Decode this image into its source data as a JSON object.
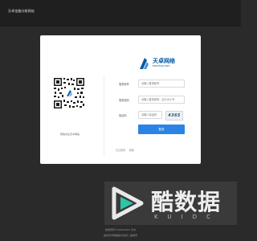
{
  "header": {
    "site_title": "天卓金路分校网站"
  },
  "login": {
    "logo_title": "天卓网络",
    "logo_subtitle": "tianzhuo.com",
    "account_label": "登录帐号",
    "account_placeholder": "请输入登录帐号",
    "password_label": "登录密码",
    "password_placeholder": "请输入登录密码，区分大小写",
    "captcha_label": "验证码",
    "captcha_placeholder": "请输入验证码",
    "captcha_code": "4365",
    "login_button": "登录",
    "link_forgot": "忘记密码",
    "link_help": "帮助"
  },
  "qr": {
    "caption": "微信关注天卓网站"
  },
  "brand": {
    "name": "酷数据",
    "letters": "KUIDC"
  },
  "footer": {
    "line1": "版权所有©2009-2021 天卓",
    "line2": "提供天卓网络技术支持 | 备案号"
  }
}
